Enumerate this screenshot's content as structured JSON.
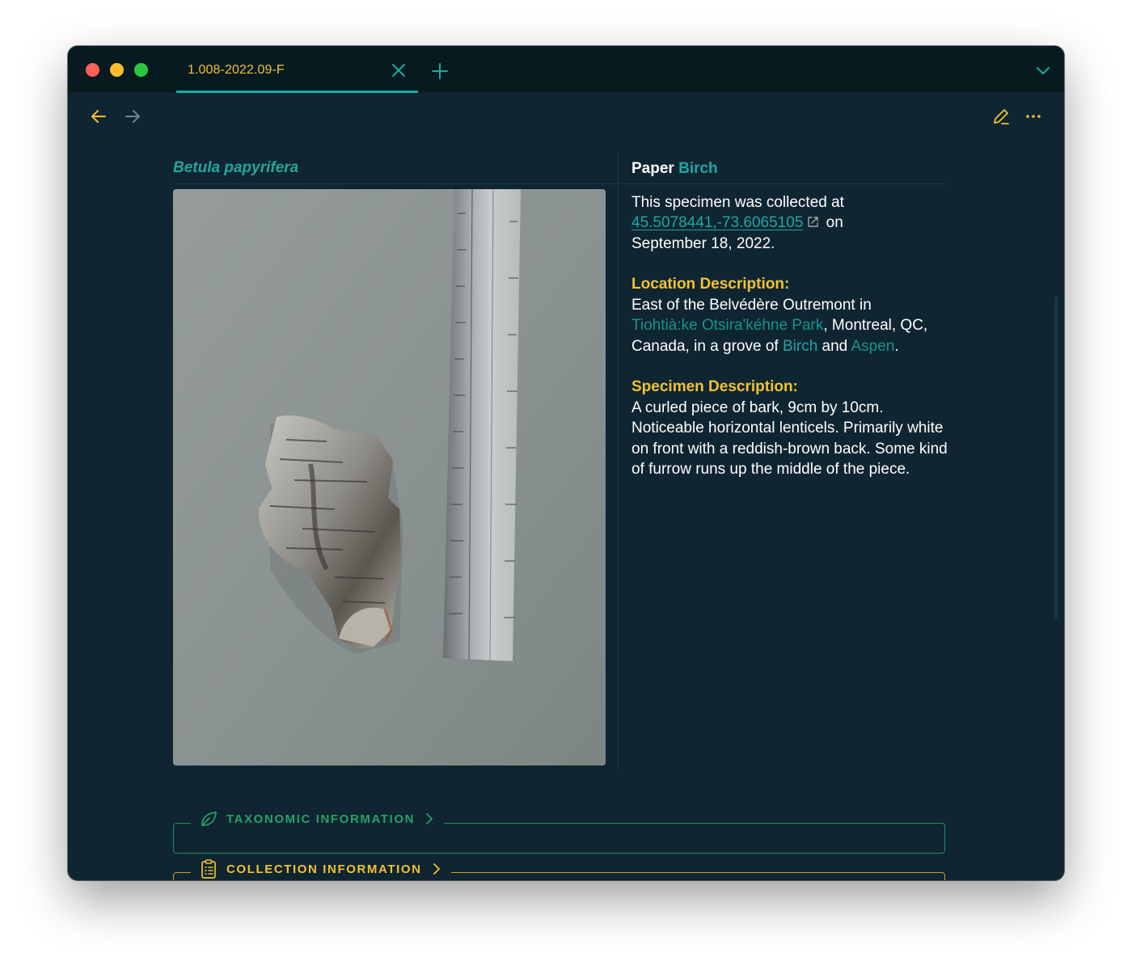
{
  "tab": {
    "title": "1.008-2022.09-F"
  },
  "specimen": {
    "scientific_name": "Betula papyrifera",
    "photo_alt": "Curled piece of birch bark beside a ruler"
  },
  "details": {
    "common_name_plain": "Paper",
    "common_name_link": "Birch",
    "collected_prefix": "This specimen was collected at",
    "coordinates": "45.5078441,-73.6065105",
    "collected_on": "on",
    "collected_date": "September 18, 2022.",
    "location": {
      "heading": "Location Description:",
      "text_1": "East of the Belvédère Outremont in",
      "park_link": "Tiohtià:ke Otsira'kéhne Park",
      "text_2": ", Montreal, QC, Canada, in a grove of",
      "birch_link": "Birch",
      "text_3": "and",
      "aspen_link": "Aspen",
      "text_4": "."
    },
    "specimen_description": {
      "heading": "Specimen Description:",
      "text": "A curled piece of bark, 9cm by 10cm. Noticeable horizontal lenticels. Primarily white on front with a reddish-brown back. Some kind of furrow runs up the middle of the piece."
    }
  },
  "callouts": {
    "taxonomic": {
      "label": "TAXONOMIC INFORMATION",
      "icon": "leaf-icon"
    },
    "collection": {
      "label": "COLLECTION INFORMATION",
      "icon": "clipboard-icon"
    }
  },
  "colors": {
    "background": "#0f2531",
    "titlebar": "#061a1f",
    "accent_yellow": "#f2c230",
    "accent_teal": "#1ca8a4",
    "callout_green": "#27a06a"
  }
}
